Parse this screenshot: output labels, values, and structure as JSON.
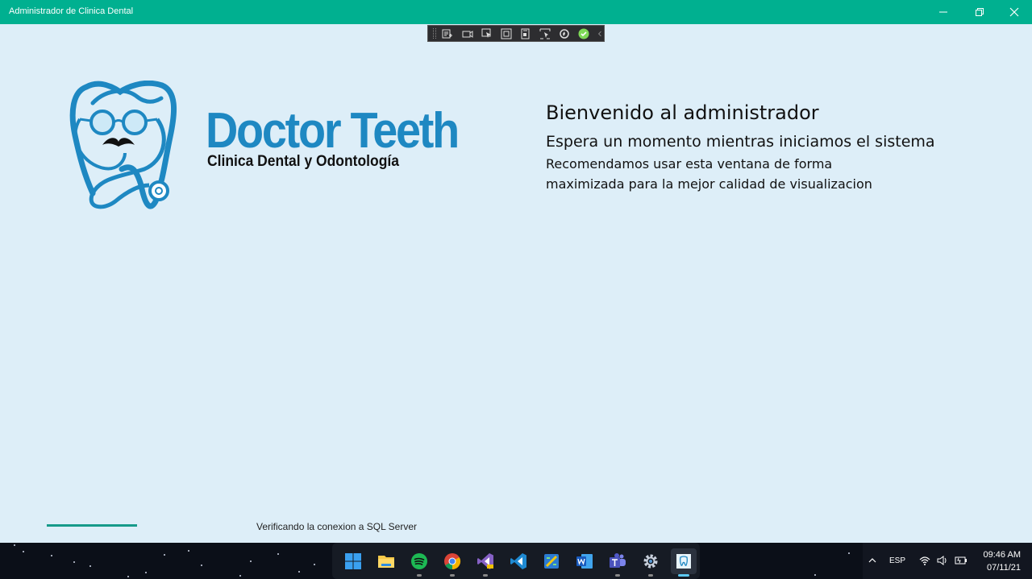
{
  "window": {
    "title": "Administrador de Clinica Dental"
  },
  "debug_toolbar": {
    "tools": [
      "go-to-live-visual-tree-icon",
      "display-layout-adorners-icon",
      "select-element-icon",
      "display-layout-bounds-icon",
      "track-focused-element-icon",
      "display-accessibility-icon",
      "hot-reload-icon",
      "check-icon",
      "collapse-icon"
    ]
  },
  "logo": {
    "brand_name": "Doctor Teeth",
    "brand_subtitle": "Clinica Dental y Odontología",
    "primary_color": "#1e88c2"
  },
  "welcome": {
    "heading": "Bienvenido al administrador",
    "subheading": "Espera un momento mientras iniciamos el sistema",
    "recommendation_line1": "Recomendamos usar esta ventana de forma",
    "recommendation_line2": "maximizada para la mejor calidad de visualizacion"
  },
  "loading": {
    "progress": 0.18,
    "status": "Verificando la conexion a SQL Server",
    "accent": "#169a8a"
  },
  "taskbar": {
    "apps": [
      "start-icon",
      "file-explorer-icon",
      "spotify-icon",
      "chrome-icon",
      "visual-studio-icon",
      "vscode-icon",
      "power-bi-icon",
      "word-icon",
      "teams-icon",
      "settings-icon",
      "dental-app-icon"
    ],
    "tray": {
      "language": "ESP",
      "time": "09:46 AM",
      "date": "07/11/21"
    }
  }
}
